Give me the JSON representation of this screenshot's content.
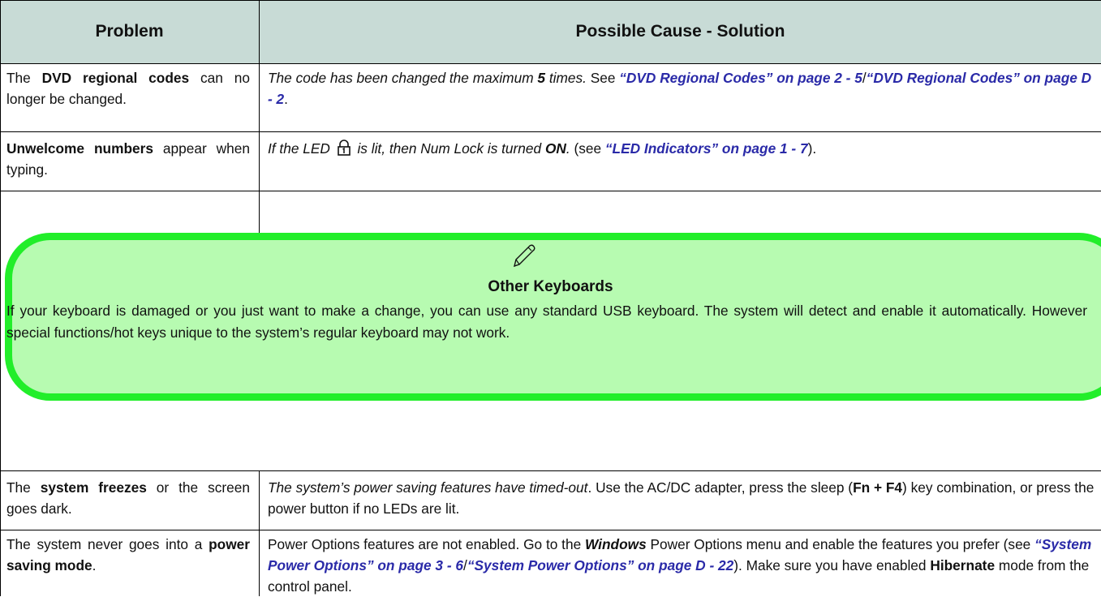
{
  "header": {
    "col1": "Problem",
    "col2": "Possible Cause - Solution"
  },
  "rows": {
    "dvd": {
      "problem": {
        "a": "The ",
        "b": "DVD regional codes",
        "c": " can no longer be changed."
      },
      "solution": {
        "a": "The code has been changed the maximum ",
        "b": "5",
        "c": " times.",
        "d": " See ",
        "link1": "“DVD Regional Codes” on page 2 - 5",
        "sep": "/",
        "link2": "“DVD Regional Codes” on page D - 2",
        "end": "."
      }
    },
    "numbers": {
      "problem": {
        "a": "Unwelcome numbers",
        "b": " appear when typing."
      },
      "solution": {
        "a": "If the LED ",
        "icon": "num-lock-icon",
        "b": " is lit, then Num Lock is turned ",
        "c": "ON",
        "d": ".",
        "e": " (see ",
        "link": "“LED Indicators” on page 1 - 7",
        "f": ")."
      }
    },
    "freeze": {
      "problem": {
        "a": "The ",
        "b": "system freezes",
        "c": " or the screen goes dark."
      },
      "solution": {
        "a": "The system’s power saving features have timed-out",
        "b": ". Use the AC/DC adapter, press the sleep (",
        "c": "Fn + F4",
        "d": ") key combination, or press the power button if no LEDs are lit."
      }
    },
    "power": {
      "problem": {
        "a": "The system never goes into a ",
        "b": "power saving mode",
        "c": "."
      },
      "solution": {
        "a": "Power Options features are not enabled. Go to the ",
        "b": "Windows",
        "c": " Power Options menu and enable the features you prefer (see ",
        "link1": "“System Power Options” on page 3 - 6",
        "sep": "/",
        "link2": "“System Power Options” on page D - 22",
        "d": "). Make sure you have enabled ",
        "e": "Hibernate",
        "f": " mode from the control panel."
      }
    }
  },
  "note": {
    "icon": "pen-icon",
    "title": "Other Keyboards",
    "body": "If your keyboard is damaged or you just want to make a change, you can use any standard USB keyboard. The system will detect and enable it automatically. However special functions/hot keys unique to the system’s regular keyboard may not work."
  },
  "colors": {
    "header_bg": "#c8dbd6",
    "note_bg": "#b7fbb1",
    "note_border": "#22ee2a",
    "link": "#2a2aa8"
  }
}
